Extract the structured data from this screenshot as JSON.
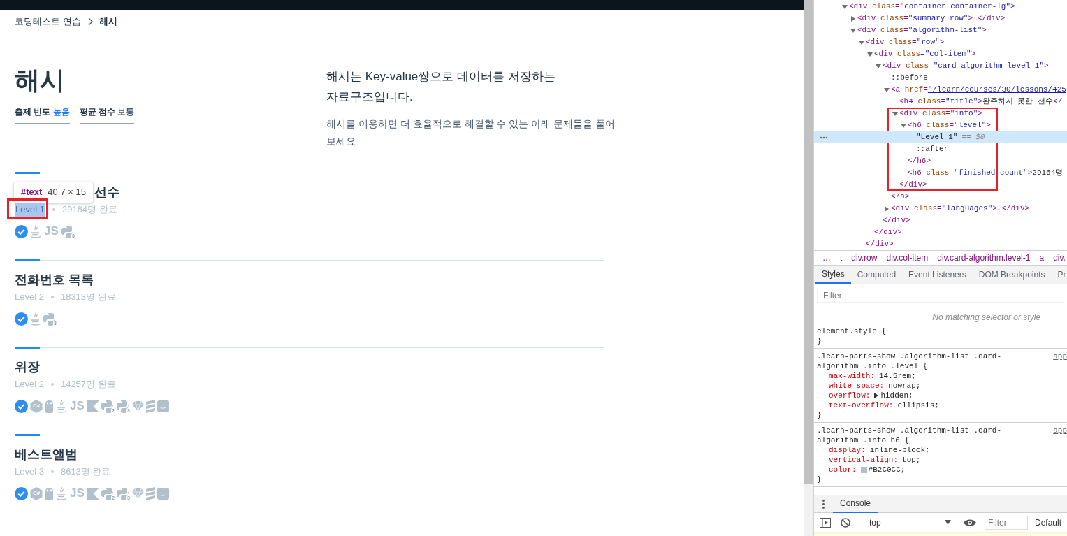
{
  "breadcrumb": [
    {
      "label": "코딩테스트 연습",
      "current": false
    },
    {
      "label": "해시",
      "current": true
    }
  ],
  "header": {
    "title": "해시",
    "tags": [
      {
        "label": "출제 빈도",
        "value": "높음",
        "color": "#1a7cff"
      },
      {
        "label": "평균 점수",
        "value": "보통",
        "color": "#44576c"
      }
    ],
    "lead": "해시는 Key-value쌍으로 데이터를 저장하는 자료구조입니다.",
    "description": "해시를 이용하면 더 효율적으로 해결할 수 있는 아래 문제들을 풀어 보세요"
  },
  "inspect_tooltip": {
    "node": "#text",
    "size": "40.7 × 15"
  },
  "problems": [
    {
      "title": "선수",
      "level": "Level 1",
      "inspected": true,
      "finished": "29164명 완료",
      "languages": [
        {
          "kind": "check"
        },
        {
          "kind": "java"
        },
        {
          "kind": "js",
          "label": "JS"
        },
        {
          "kind": "python",
          "label": "3"
        }
      ]
    },
    {
      "title": "전화번호 목록",
      "level": "Level 2",
      "inspected": false,
      "finished": "18313명 완료",
      "languages": [
        {
          "kind": "check"
        },
        {
          "kind": "java"
        },
        {
          "kind": "python",
          "label": "3"
        }
      ]
    },
    {
      "title": "위장",
      "level": "Level 2",
      "inspected": false,
      "finished": "14257명 완료",
      "languages": [
        {
          "kind": "check"
        },
        {
          "kind": "csharp",
          "label": "C#"
        },
        {
          "kind": "go"
        },
        {
          "kind": "java"
        },
        {
          "kind": "js",
          "label": "JS"
        },
        {
          "kind": "kotlin"
        },
        {
          "kind": "python",
          "label": "2"
        },
        {
          "kind": "python",
          "label": "3"
        },
        {
          "kind": "ruby"
        },
        {
          "kind": "scala"
        },
        {
          "kind": "swift"
        }
      ]
    },
    {
      "title": "베스트앨범",
      "level": "Level 3",
      "inspected": false,
      "finished": "8613명 완료",
      "languages": [
        {
          "kind": "check"
        },
        {
          "kind": "csharp",
          "label": "C#"
        },
        {
          "kind": "go"
        },
        {
          "kind": "java"
        },
        {
          "kind": "js",
          "label": "JS"
        },
        {
          "kind": "kotlin"
        },
        {
          "kind": "python",
          "label": "2"
        },
        {
          "kind": "python",
          "label": "3"
        },
        {
          "kind": "ruby"
        },
        {
          "kind": "scala"
        },
        {
          "kind": "swift"
        }
      ]
    }
  ],
  "devtools": {
    "dom_tree": [
      {
        "text": "<div class=\"container container-lg\">",
        "expanded": true,
        "children": [
          {
            "text": "<div class=\"summary row\">…</div>",
            "expanded": false
          },
          {
            "text": "<div class=\"algorithm-list\">",
            "expanded": true,
            "children": [
              {
                "text": "<div class=\"row\">",
                "expanded": true,
                "close": "</div>",
                "children": [
                  {
                    "text": "<div class=\"col-item\">",
                    "expanded": true,
                    "close": "</div>",
                    "children": [
                      {
                        "text": "<div class=\"card-algorithm level-1\">",
                        "expanded": true,
                        "close": "</div>",
                        "children": [
                          {
                            "text": "::before"
                          },
                          {
                            "text": "<a href=\"/learn/courses/30/lessons/425",
                            "expanded": true,
                            "link": true,
                            "close": "</a>",
                            "children": [
                              {
                                "text": "<h4 class=\"title\">완주하지 못한 선수</"
                              },
                              {
                                "text": "<div class=\"info\">",
                                "expanded": true,
                                "outlined": true,
                                "close": "</div>",
                                "children": [
                                  {
                                    "text": "<h6 class=\"level\">",
                                    "expanded": true,
                                    "close": "</h6>",
                                    "children": [
                                      {
                                        "text": "\"Level 1\"",
                                        "note": "== $0",
                                        "selected": true
                                      },
                                      {
                                        "text": "::after"
                                      }
                                    ]
                                  },
                                  {
                                    "text": "<h6 class=\"finished-count\">29164명"
                                  }
                                ]
                              }
                            ]
                          },
                          {
                            "text": "<div class=\"languages\">…</div>",
                            "expanded": false
                          }
                        ]
                      }
                    ]
                  }
                ]
              }
            ]
          }
        ]
      }
    ],
    "path": [
      "…",
      "t",
      "div.row",
      "div.col-item",
      "div.card-algorithm.level-1",
      "a",
      "div."
    ],
    "tabs": [
      {
        "label": "Styles",
        "selected": true
      },
      {
        "label": "Computed",
        "selected": false
      },
      {
        "label": "Event Listeners",
        "selected": false
      },
      {
        "label": "DOM Breakpoints",
        "selected": false
      },
      {
        "label": "Pr",
        "selected": false
      }
    ],
    "filter_placeholder": "Filter",
    "empty_note": "No matching selector or style",
    "rules": [
      {
        "selector": "element.style {",
        "close": "}"
      },
      {
        "selector": ".learn-parts-show .algorithm-list .card-algorithm .info .level {",
        "source": "app",
        "close": "}",
        "declarations": [
          {
            "property": "max-width:",
            "value": "14.5rem;"
          },
          {
            "property": "white-space:",
            "value": "nowrap;"
          },
          {
            "property": "overflow:",
            "value": "hidden;",
            "expandable": true
          },
          {
            "property": "text-overflow:",
            "value": "ellipsis;"
          }
        ]
      },
      {
        "selector": ".learn-parts-show .algorithm-list .card-algorithm .info h6 {",
        "source": "app",
        "close": "}",
        "declarations": [
          {
            "property": "display:",
            "value": "inline-block;"
          },
          {
            "property": "vertical-align:",
            "value": "top;"
          },
          {
            "property": "color:",
            "value": "#B2C0CC;",
            "color": "#b2c0cc"
          }
        ]
      }
    ],
    "drawer_tab": "Console",
    "context": "top",
    "console_filter_placeholder": "Filter",
    "levels": "Default"
  }
}
